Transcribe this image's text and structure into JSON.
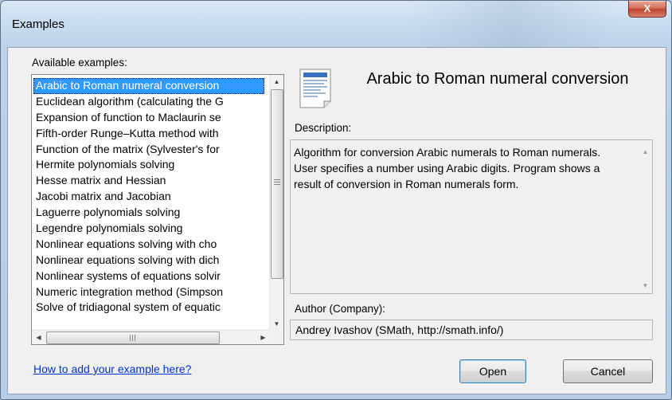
{
  "window": {
    "title": "Examples",
    "close_glyph": "X"
  },
  "available": {
    "label": "Available examples:",
    "items": [
      "Arabic to Roman numeral conversion",
      "Euclidean algorithm (calculating the G",
      "Expansion of function to Maclaurin se",
      "Fifth-order Runge–Kutta method with",
      "Function of the matrix (Sylvester's for",
      "Hermite polynomials solving",
      "Hesse matrix and Hessian",
      "Jacobi matrix and Jacobian",
      "Laguerre polynomials solving",
      "Legendre polynomials solving",
      "Nonlinear equations solving with cho",
      "Nonlinear equations solving with dich",
      "Nonlinear systems of equations solvir",
      "Numeric integration method (Simpson",
      "Solve of tridiagonal system of equatic"
    ],
    "selected_index": 0,
    "scroll": {
      "up_glyph": "▲",
      "down_glyph": "▼",
      "left_glyph": "◀",
      "right_glyph": "▶"
    }
  },
  "detail": {
    "icon": "document-icon",
    "title": "Arabic to Roman numeral conversion",
    "description_label": "Description:",
    "description": "Algorithm for conversion Arabic numerals to Roman numerals.\nUser specifies a number using Arabic digits. Program shows a result of conversion in Roman numerals form.",
    "author_label": "Author (Company):",
    "author": "Andrey Ivashov (SMath, http://smath.info/)"
  },
  "footer": {
    "link": "How to add your example here?",
    "open_label": "Open",
    "cancel_label": "Cancel"
  },
  "colors": {
    "selection": "#3399ff",
    "link": "#0033cc",
    "close_button": "#c0432d"
  }
}
